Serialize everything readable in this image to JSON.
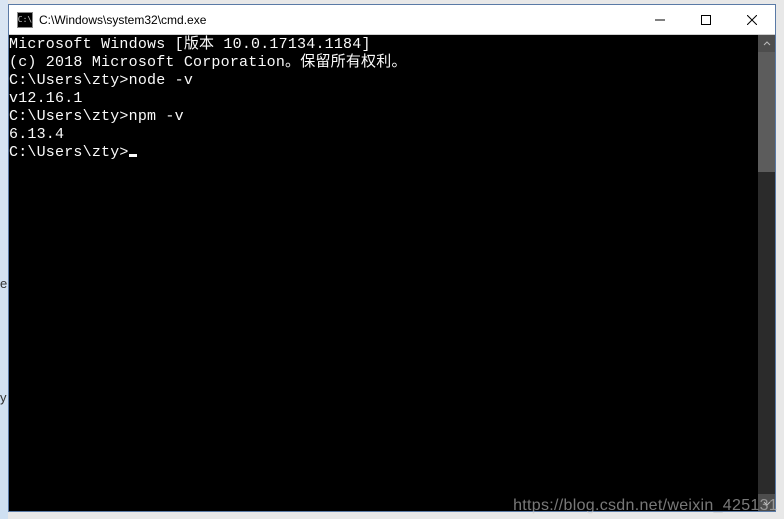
{
  "window": {
    "title": "C:\\Windows\\system32\\cmd.exe",
    "icon_label": "C:\\"
  },
  "controls": {
    "minimize": "minimize",
    "maximize": "maximize",
    "close": "close"
  },
  "terminal": {
    "lines": [
      "Microsoft Windows [版本 10.0.17134.1184]",
      "(c) 2018 Microsoft Corporation。保留所有权利。",
      "",
      "C:\\Users\\zty>node -v",
      "v12.16.1",
      "",
      "C:\\Users\\zty>npm -v",
      "6.13.4",
      "",
      "C:\\Users\\zty>"
    ],
    "prompt": "C:\\Users\\zty>",
    "commands": [
      {
        "cmd": "node -v",
        "output": "v12.16.1"
      },
      {
        "cmd": "npm -v",
        "output": "6.13.4"
      }
    ]
  },
  "watermark": "https://blog.csdn.net/weixin_425131"
}
